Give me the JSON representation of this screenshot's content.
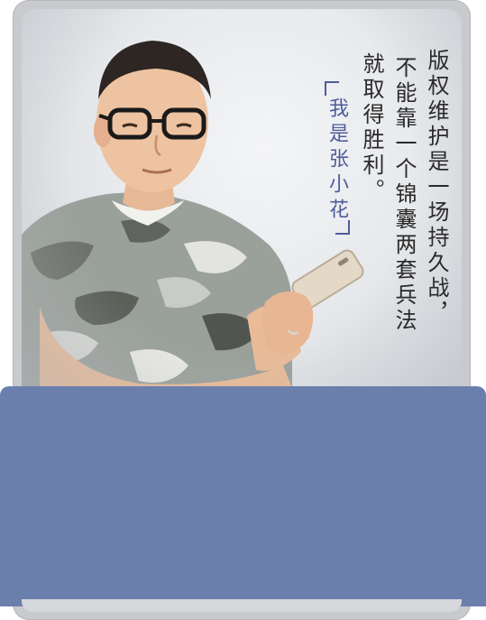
{
  "quote": {
    "columns": [
      "版权维护是一场持久战，",
      "不能靠一个锦囊两套兵法",
      "就取得胜利。"
    ]
  },
  "signature": {
    "text": "我是张小花"
  },
  "colors": {
    "panel": "#6b7fad",
    "frame": "#c9cacd",
    "signature": "#4e5c9a"
  }
}
